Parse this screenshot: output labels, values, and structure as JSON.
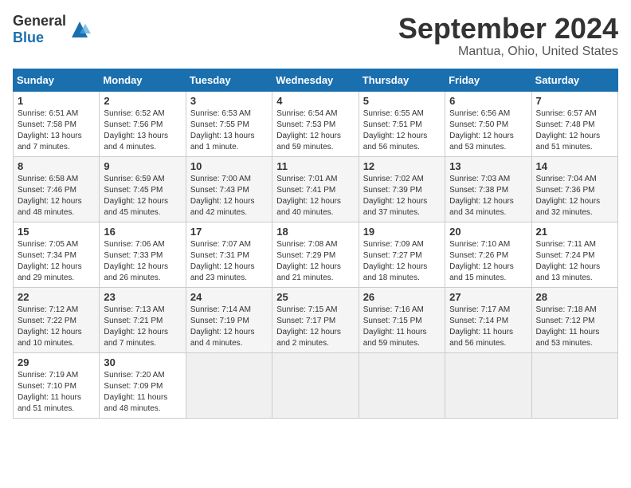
{
  "header": {
    "logo_general": "General",
    "logo_blue": "Blue",
    "title": "September 2024",
    "location": "Mantua, Ohio, United States"
  },
  "calendar": {
    "days_of_week": [
      "Sunday",
      "Monday",
      "Tuesday",
      "Wednesday",
      "Thursday",
      "Friday",
      "Saturday"
    ],
    "weeks": [
      [
        {
          "day": "1",
          "sunrise": "6:51 AM",
          "sunset": "7:58 PM",
          "daylight": "13 hours and 7 minutes."
        },
        {
          "day": "2",
          "sunrise": "6:52 AM",
          "sunset": "7:56 PM",
          "daylight": "13 hours and 4 minutes."
        },
        {
          "day": "3",
          "sunrise": "6:53 AM",
          "sunset": "7:55 PM",
          "daylight": "13 hours and 1 minute."
        },
        {
          "day": "4",
          "sunrise": "6:54 AM",
          "sunset": "7:53 PM",
          "daylight": "12 hours and 59 minutes."
        },
        {
          "day": "5",
          "sunrise": "6:55 AM",
          "sunset": "7:51 PM",
          "daylight": "12 hours and 56 minutes."
        },
        {
          "day": "6",
          "sunrise": "6:56 AM",
          "sunset": "7:50 PM",
          "daylight": "12 hours and 53 minutes."
        },
        {
          "day": "7",
          "sunrise": "6:57 AM",
          "sunset": "7:48 PM",
          "daylight": "12 hours and 51 minutes."
        }
      ],
      [
        {
          "day": "8",
          "sunrise": "6:58 AM",
          "sunset": "7:46 PM",
          "daylight": "12 hours and 48 minutes."
        },
        {
          "day": "9",
          "sunrise": "6:59 AM",
          "sunset": "7:45 PM",
          "daylight": "12 hours and 45 minutes."
        },
        {
          "day": "10",
          "sunrise": "7:00 AM",
          "sunset": "7:43 PM",
          "daylight": "12 hours and 42 minutes."
        },
        {
          "day": "11",
          "sunrise": "7:01 AM",
          "sunset": "7:41 PM",
          "daylight": "12 hours and 40 minutes."
        },
        {
          "day": "12",
          "sunrise": "7:02 AM",
          "sunset": "7:39 PM",
          "daylight": "12 hours and 37 minutes."
        },
        {
          "day": "13",
          "sunrise": "7:03 AM",
          "sunset": "7:38 PM",
          "daylight": "12 hours and 34 minutes."
        },
        {
          "day": "14",
          "sunrise": "7:04 AM",
          "sunset": "7:36 PM",
          "daylight": "12 hours and 32 minutes."
        }
      ],
      [
        {
          "day": "15",
          "sunrise": "7:05 AM",
          "sunset": "7:34 PM",
          "daylight": "12 hours and 29 minutes."
        },
        {
          "day": "16",
          "sunrise": "7:06 AM",
          "sunset": "7:33 PM",
          "daylight": "12 hours and 26 minutes."
        },
        {
          "day": "17",
          "sunrise": "7:07 AM",
          "sunset": "7:31 PM",
          "daylight": "12 hours and 23 minutes."
        },
        {
          "day": "18",
          "sunrise": "7:08 AM",
          "sunset": "7:29 PM",
          "daylight": "12 hours and 21 minutes."
        },
        {
          "day": "19",
          "sunrise": "7:09 AM",
          "sunset": "7:27 PM",
          "daylight": "12 hours and 18 minutes."
        },
        {
          "day": "20",
          "sunrise": "7:10 AM",
          "sunset": "7:26 PM",
          "daylight": "12 hours and 15 minutes."
        },
        {
          "day": "21",
          "sunrise": "7:11 AM",
          "sunset": "7:24 PM",
          "daylight": "12 hours and 13 minutes."
        }
      ],
      [
        {
          "day": "22",
          "sunrise": "7:12 AM",
          "sunset": "7:22 PM",
          "daylight": "12 hours and 10 minutes."
        },
        {
          "day": "23",
          "sunrise": "7:13 AM",
          "sunset": "7:21 PM",
          "daylight": "12 hours and 7 minutes."
        },
        {
          "day": "24",
          "sunrise": "7:14 AM",
          "sunset": "7:19 PM",
          "daylight": "12 hours and 4 minutes."
        },
        {
          "day": "25",
          "sunrise": "7:15 AM",
          "sunset": "7:17 PM",
          "daylight": "12 hours and 2 minutes."
        },
        {
          "day": "26",
          "sunrise": "7:16 AM",
          "sunset": "7:15 PM",
          "daylight": "11 hours and 59 minutes."
        },
        {
          "day": "27",
          "sunrise": "7:17 AM",
          "sunset": "7:14 PM",
          "daylight": "11 hours and 56 minutes."
        },
        {
          "day": "28",
          "sunrise": "7:18 AM",
          "sunset": "7:12 PM",
          "daylight": "11 hours and 53 minutes."
        }
      ],
      [
        {
          "day": "29",
          "sunrise": "7:19 AM",
          "sunset": "7:10 PM",
          "daylight": "11 hours and 51 minutes."
        },
        {
          "day": "30",
          "sunrise": "7:20 AM",
          "sunset": "7:09 PM",
          "daylight": "11 hours and 48 minutes."
        },
        null,
        null,
        null,
        null,
        null
      ]
    ]
  }
}
